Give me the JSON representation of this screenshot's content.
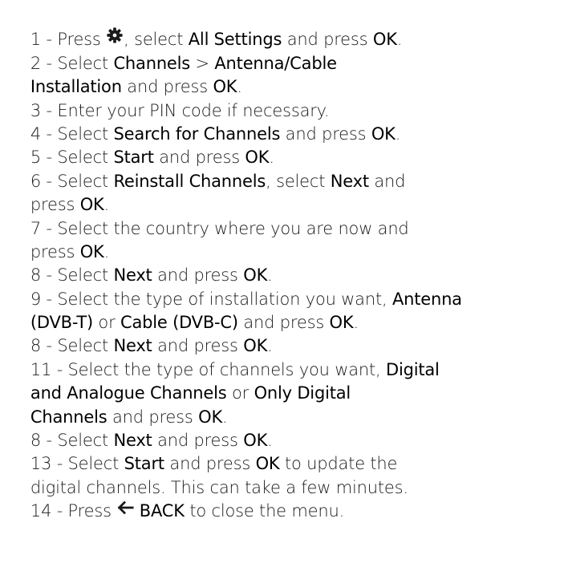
{
  "icons": {
    "settings": "gear-icon",
    "back": "back-arrow-icon"
  },
  "steps": [
    {
      "segments": [
        "1 - Press ",
        ", select ",
        "All Settings",
        " and press ",
        "OK",
        "."
      ]
    },
    {
      "segments": [
        "2 - Select ",
        "Channels",
        " > ",
        "Antenna/Cable"
      ]
    },
    {
      "segments": [
        "Installation",
        " and press ",
        "OK",
        "."
      ]
    },
    {
      "segments": [
        "3 - Enter your PIN code if necessary."
      ]
    },
    {
      "segments": [
        "4 - Select ",
        "Search for Channels",
        " and press ",
        "OK",
        "."
      ]
    },
    {
      "segments": [
        "5 - Select ",
        "Start",
        " and press ",
        "OK",
        "."
      ]
    },
    {
      "segments": [
        "6 - Select ",
        "Reinstall Channels",
        ", select ",
        "Next",
        " and"
      ]
    },
    {
      "segments": [
        "press ",
        "OK",
        "."
      ]
    },
    {
      "segments": [
        "7 - Select the country where you are now and"
      ]
    },
    {
      "segments": [
        "press ",
        "OK",
        "."
      ]
    },
    {
      "segments": [
        "8 - Select ",
        "Next",
        " and press ",
        "OK",
        "."
      ]
    },
    {
      "segments": [
        "9 - Select the type of installation you want, ",
        "Antenna"
      ]
    },
    {
      "segments": [
        "(DVB-T)",
        " or ",
        "Cable (DVB-C)",
        " and press ",
        "OK",
        "."
      ]
    },
    {
      "segments": [
        "8 - Select ",
        "Next",
        " and press ",
        "OK",
        "."
      ]
    },
    {
      "segments": [
        "11 - Select the type of channels you want, ",
        "Digital"
      ]
    },
    {
      "segments": [
        "and Analogue Channels",
        " or ",
        "Only Digital"
      ]
    },
    {
      "segments": [
        "Channels",
        " and press ",
        "OK",
        "."
      ]
    },
    {
      "segments": [
        "8 - Select ",
        "Next",
        " and press ",
        "OK",
        "."
      ]
    },
    {
      "segments": [
        "13 - Select ",
        "Start",
        " and press ",
        "OK",
        " to update the"
      ]
    },
    {
      "segments": [
        "digital channels. This can take a few minutes."
      ]
    },
    {
      "segments": [
        "14 - Press ",
        "BACK",
        " to close the menu."
      ]
    }
  ]
}
